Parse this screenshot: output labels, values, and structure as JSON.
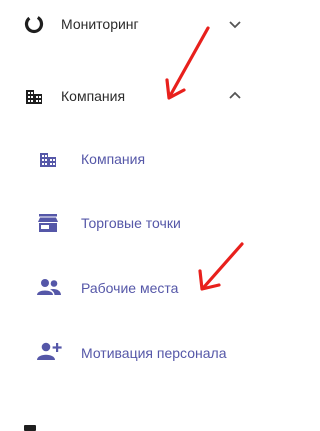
{
  "menu": {
    "monitoring": {
      "label": "Мониторинг",
      "icon": "monitoring-ring-icon",
      "chevron": "chevron-down-icon"
    },
    "company": {
      "label": "Компания",
      "icon": "building-icon",
      "chevron": "chevron-up-icon"
    },
    "submenu": [
      {
        "label": "Компания",
        "icon": "building-icon"
      },
      {
        "label": "Торговые точки",
        "icon": "store-icon"
      },
      {
        "label": "Рабочие места",
        "icon": "people-icon"
      },
      {
        "label": "Мотивация персонала",
        "icon": "person-add-icon"
      }
    ]
  },
  "colors": {
    "accent": "#5557a8",
    "text": "#2b2b2b",
    "annotation_arrow": "#e8201c"
  }
}
